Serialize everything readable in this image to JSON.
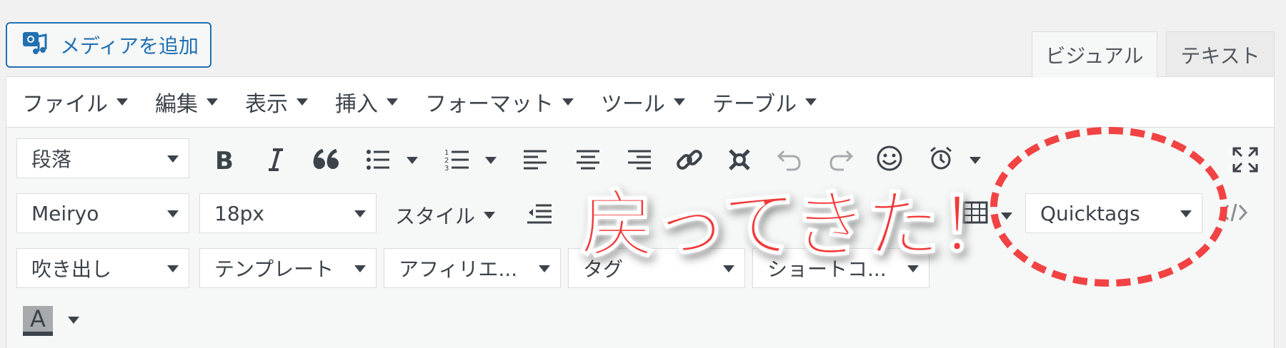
{
  "media_button": {
    "label": "メディアを追加",
    "icon": "media-camera-music-icon"
  },
  "tabs": [
    {
      "label": "ビジュアル"
    },
    {
      "label": "テキスト"
    }
  ],
  "menubar": [
    {
      "label": "ファイル"
    },
    {
      "label": "編集"
    },
    {
      "label": "表示"
    },
    {
      "label": "挿入"
    },
    {
      "label": "フォーマット"
    },
    {
      "label": "ツール"
    },
    {
      "label": "テーブル"
    }
  ],
  "toolbar": {
    "row1": {
      "format_select": "段落",
      "icons": [
        "bold-icon",
        "italic-icon",
        "blockquote-icon",
        "bullet-list-icon",
        "numbered-list-icon",
        "align-left-icon",
        "align-center-icon",
        "align-right-icon",
        "link-icon",
        "unlink-icon",
        "undo-icon",
        "redo-icon",
        "emoji-icon",
        "alarm-clock-icon",
        "fullscreen-icon"
      ]
    },
    "row2": {
      "font_select": "Meiryo",
      "size_select": "18px",
      "style_label": "スタイル",
      "quicktags_select": "Quicktags",
      "icons": [
        "outdent-icon",
        "table-icon",
        "code-icon"
      ]
    },
    "row3": {
      "selects": [
        {
          "label": "吹き出し"
        },
        {
          "label": "テンプレート"
        },
        {
          "label": "アフィリエ..."
        },
        {
          "label": "タグ"
        },
        {
          "label": "ショートコ..."
        }
      ]
    },
    "row4": {
      "text_color_label": "A"
    }
  },
  "annotation": {
    "text": "戻ってきた！",
    "color": "#f13a3a",
    "ellipse_color": "#f14343"
  }
}
